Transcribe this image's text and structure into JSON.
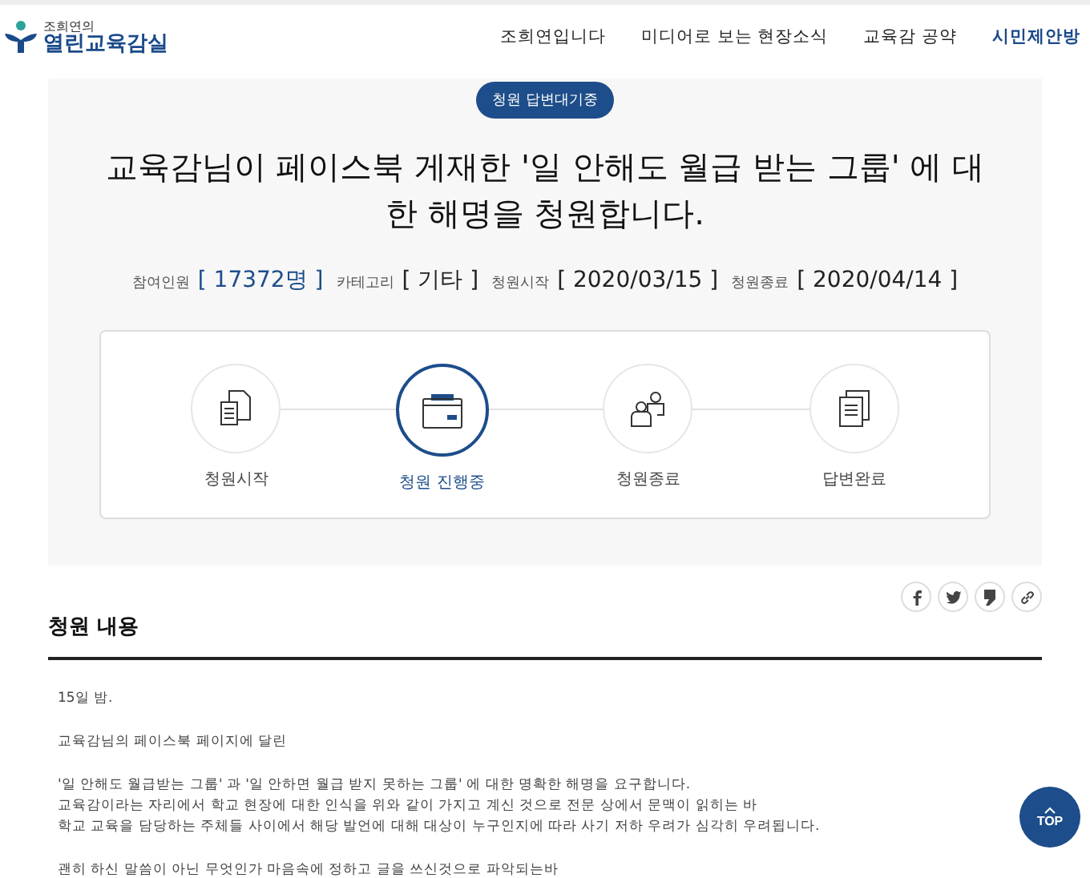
{
  "logo": {
    "small": "조희연의",
    "large": "열린교육감실"
  },
  "nav": [
    {
      "label": "조희연입니다",
      "selected": false
    },
    {
      "label": "미디어로 보는 현장소식",
      "selected": false
    },
    {
      "label": "교육감 공약",
      "selected": false
    },
    {
      "label": "시민제안방",
      "selected": true
    }
  ],
  "badge": "청원 답변대기중",
  "title": "교육감님이 페이스북 게재한 '일 안해도 월급 받는 그룹' 에 대한 해명을 청원합니다.",
  "meta": [
    {
      "label": "참여인원",
      "value": "[ 17372명 ]",
      "highlight": true
    },
    {
      "label": "카테고리",
      "value": "[ 기타 ]",
      "highlight": false
    },
    {
      "label": "청원시작",
      "value": "[ 2020/03/15 ]",
      "highlight": false
    },
    {
      "label": "청원종료",
      "value": "[ 2020/04/14 ]",
      "highlight": false
    }
  ],
  "steps": [
    {
      "label": "청원시작",
      "kind": "document",
      "selected": false
    },
    {
      "label": "청원 진행중",
      "kind": "folder",
      "selected": true
    },
    {
      "label": "청원종료",
      "kind": "people",
      "selected": false
    },
    {
      "label": "답변완료",
      "kind": "pages",
      "selected": false
    }
  ],
  "share": [
    {
      "kind": "facebook"
    },
    {
      "kind": "twitter"
    },
    {
      "kind": "quote"
    },
    {
      "kind": "link"
    }
  ],
  "section_title": "청원 내용",
  "paragraphs": [
    [
      "15일 밤."
    ],
    [
      "교육감님의 페이스북 페이지에 달린"
    ],
    [
      "'일 안해도 월급받는 그룹' 과 '일 안하면 월급 받지 못하는 그룹' 에 대한 명확한 해명을 요구합니다.",
      "교육감이라는 자리에서 학교 현장에 대한 인식을 위와 같이 가지고 계신 것으로 전문 상에서 문맥이 읽히는 바",
      "학교 교육을 담당하는 주체들 사이에서 해당 발언에 대해 대상이 누구인지에 따라 사기 저하 우려가 심각히 우려됩니다."
    ],
    [
      "괜히 하신 말씀이 아닌 무엇인가 마음속에 정하고 글을 쓰신것으로 파악되는바"
    ]
  ],
  "top_button": "TOP"
}
